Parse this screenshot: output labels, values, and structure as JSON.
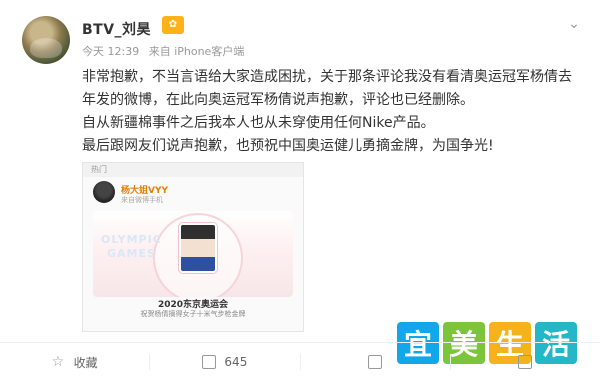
{
  "post": {
    "user": {
      "name": "BTV_刘昊",
      "badge": "✿"
    },
    "meta": {
      "time": "今天 12:39",
      "source": "来自 iPhone客户端"
    },
    "content": {
      "line1": "非常抱歉，不当言语给大家造成困扰，关于那条评论我没有看清奥运冠军杨倩去",
      "line2": "年发的微博，在此向奥运冠军杨倩说声抱歉，评论也已经删除。",
      "line3": "自从新疆棉事件之后我本人也从未穿使用任何Nike产品。",
      "line4": "最后跟网友们说声抱歉，也预祝中国奥运健儿勇摘金牌，为国争光!"
    },
    "card": {
      "topbar": "热门",
      "user": "杨大姐VYY",
      "sub": "来自微博手机",
      "olympic1": "OLYMPIC",
      "olympic2": "GAMES",
      "title": "2020东京奥运会",
      "desc": "祝贺杨倩摘得女子十米气步枪金牌"
    },
    "watermark": {
      "chars": [
        "宜",
        "美",
        "生",
        "活"
      ]
    },
    "actions": {
      "collect": "收藏",
      "repost_count": "645"
    }
  }
}
